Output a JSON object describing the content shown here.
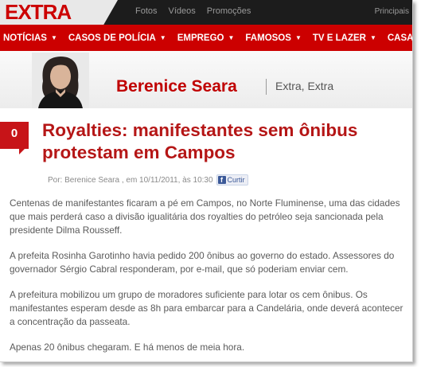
{
  "topbar": {
    "logo": "EXTRA",
    "nav": [
      "Fotos",
      "Vídeos",
      "Promoções"
    ],
    "right": "Principais"
  },
  "mainnav": {
    "items": [
      "NOTÍCIAS",
      "CASOS DE POLÍCIA",
      "EMPREGO",
      "FAMOSOS",
      "TV E LAZER",
      "CASA"
    ]
  },
  "column": {
    "name": "Berenice Seara",
    "section": "Extra, Extra"
  },
  "article": {
    "comment_count": "0",
    "headline": "Royalties: manifestantes sem ônibus protestam em Campos",
    "byline_prefix": "Por: Berenice Seara , em 10/11/2011, às 10:30",
    "like_label": "Curtir",
    "paragraphs": [
      "Centenas de manifestantes ficaram a pé em Campos, no Norte Fluminense, uma das cidades que mais perderá caso a divisão igualitária dos royalties do petróleo seja sancionada pela presidente Dilma Rousseff.",
      "A prefeita Rosinha Garotinho havia pedido 200 ônibus ao governo do estado. Assessores do governador Sérgio Cabral responderam, por e-mail, que só poderiam enviar cem.",
      "A prefeitura mobilizou um grupo de moradores suficiente para lotar os cem ônibus. Os manifestantes esperam desde as 8h para embarcar para a Candelária, onde deverá acontecer a concentração da passeata.",
      "Apenas 20 ônibus chegaram. E há menos de meia hora."
    ]
  },
  "colors": {
    "brand_red": "#cc0000",
    "headline_red": "#b51616",
    "topbar_dark": "#1c1c1c"
  }
}
